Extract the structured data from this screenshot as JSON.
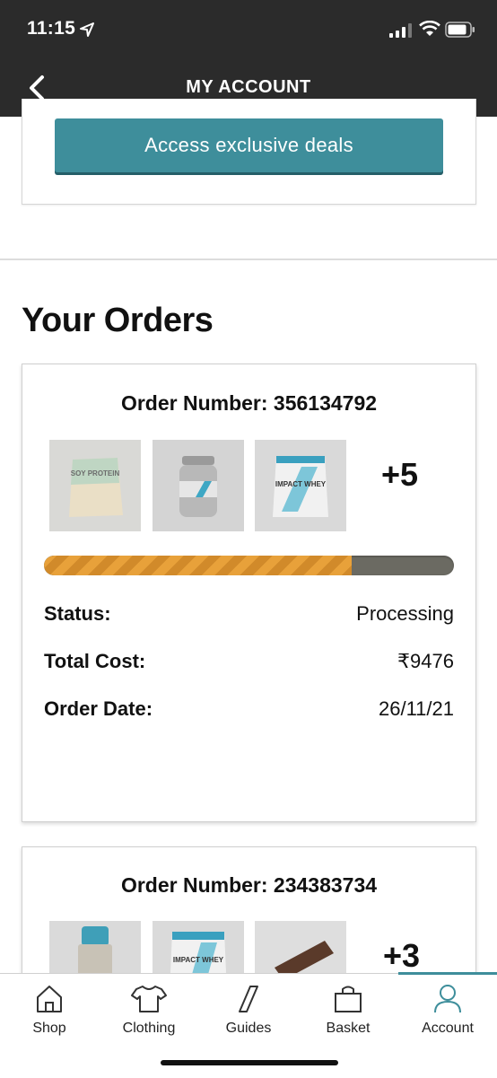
{
  "status_bar": {
    "time": "11:15"
  },
  "header": {
    "title": "MY ACCOUNT"
  },
  "deals": {
    "button_label": "Access exclusive deals"
  },
  "orders_section": {
    "title": "Your Orders"
  },
  "orders": [
    {
      "number_label": "Order Number: 356134792",
      "extra_items": "+5",
      "progress": 0.75,
      "status_label": "Status:",
      "status_value": "Processing",
      "total_label": "Total Cost:",
      "total_value": "₹9476",
      "date_label": "Order Date:",
      "date_value": "26/11/21",
      "thumbnails": [
        {
          "name": "soy-protein-pouch",
          "text": "SOY PROTEIN"
        },
        {
          "name": "capsule-tub",
          "text": ""
        },
        {
          "name": "impact-whey-pouch",
          "text": "IMPACT WHEY"
        }
      ]
    },
    {
      "number_label": "Order Number: 234383734",
      "extra_items": "+3",
      "thumbnails": [
        {
          "name": "shaker-bottle",
          "text": ""
        },
        {
          "name": "impact-whey-pouch",
          "text": "IMPACT WHEY"
        },
        {
          "name": "protein-bar",
          "text": ""
        }
      ]
    }
  ],
  "tabs": [
    {
      "label": "Shop",
      "icon": "home-icon"
    },
    {
      "label": "Clothing",
      "icon": "tshirt-icon"
    },
    {
      "label": "Guides",
      "icon": "guides-icon"
    },
    {
      "label": "Basket",
      "icon": "bag-icon"
    },
    {
      "label": "Account",
      "icon": "person-icon",
      "active": true
    }
  ],
  "colors": {
    "accent": "#3e8e9b",
    "header": "#2b2b2b",
    "progress": "#e8a13a"
  }
}
